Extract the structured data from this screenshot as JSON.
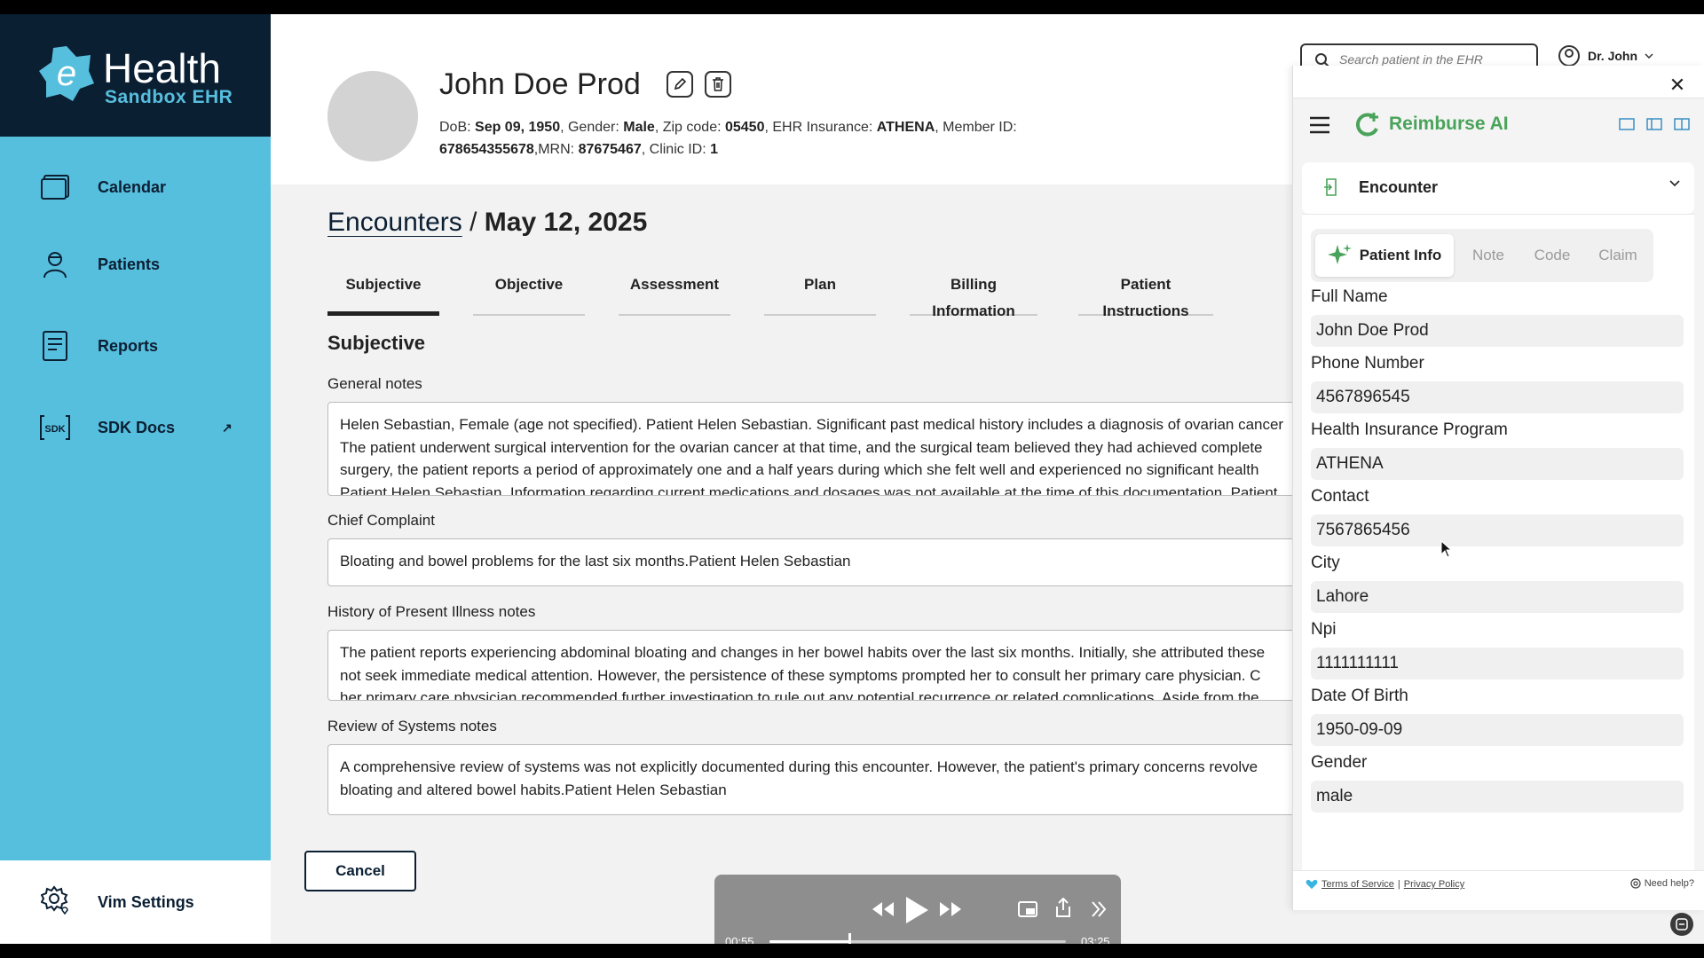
{
  "brand": {
    "name": "Health",
    "subtitle": "Sandbox EHR"
  },
  "sidebar": {
    "items": [
      {
        "label": "Calendar",
        "icon": "calendar-icon"
      },
      {
        "label": "Patients",
        "icon": "user-icon"
      },
      {
        "label": "Reports",
        "icon": "report-icon"
      },
      {
        "label": "SDK Docs",
        "icon": "sdk-icon",
        "external": "↗"
      }
    ],
    "settings_label": "Vim Settings"
  },
  "header": {
    "patient_name": "John Doe Prod",
    "dob_label": "DoB: ",
    "dob": "Sep 09, 1950",
    "gender_label": ", Gender: ",
    "gender": "Male",
    "zip_label": ", Zip code: ",
    "zip": "05450",
    "insurance_label": ", EHR Insurance: ",
    "insurance": "ATHENA",
    "member_label": ", Member ID: ",
    "member_id": "678654355678",
    "mrn_label": ",MRN: ",
    "mrn": "87675467",
    "clinic_label": ", Clinic ID: ",
    "clinic_id": "1",
    "search_placeholder": "Search patient in the EHR",
    "user_name": "Dr. John"
  },
  "breadcrumb": {
    "link": "Encounters",
    "separator": " / ",
    "current": "May 12, 2025"
  },
  "tabs": [
    "Subjective",
    "Objective",
    "Assessment",
    "Plan",
    "Billing Information",
    "Patient Instructions"
  ],
  "section_title": "Subjective",
  "fields": {
    "general_notes": {
      "label": "General notes",
      "lines": [
        "Helen Sebastian, Female (age not specified). Patient Helen Sebastian. Significant past medical history includes a diagnosis of ovarian cancer",
        "The patient underwent surgical intervention for the ovarian cancer at that time, and the surgical team believed they had achieved complete",
        "surgery, the patient reports a period of approximately one and a half years during which she felt well and experienced no significant health",
        "Patient Helen Sebastian. Information regarding current medications and dosages was not available at the time of this documentation. Patient"
      ]
    },
    "chief_complaint": {
      "label": "Chief Complaint",
      "lines": [
        "Bloating and bowel problems for the last six months.Patient Helen Sebastian"
      ]
    },
    "hpi": {
      "label": "History of Present Illness notes",
      "lines": [
        "The patient reports experiencing abdominal bloating and changes in her bowel habits over the last six months. Initially, she attributed these",
        "not seek immediate medical attention.  However, the persistence of these symptoms prompted her to consult her primary care physician.  C",
        "her primary care physician recommended further investigation to rule out any potential recurrence or related complications.  Aside from the"
      ]
    },
    "ros": {
      "label": "Review of Systems notes",
      "lines": [
        "A comprehensive review of systems was not explicitly documented during this encounter. However, the patient's primary concerns revolve",
        "bloating and altered bowel habits.Patient Helen Sebastian"
      ]
    }
  },
  "cancel_label": "Cancel",
  "player": {
    "current_time": "00:55",
    "total_time": "03:25",
    "progress": 0.268
  },
  "panel": {
    "app_name": "Reimburse AI",
    "section": "Encounter",
    "tabs": [
      "Patient Info",
      "Note",
      "Code",
      "Claim"
    ],
    "patient_info": [
      {
        "label": "Full Name",
        "value": "John Doe Prod"
      },
      {
        "label": "Phone Number",
        "value": "4567896545"
      },
      {
        "label": "Health Insurance Program",
        "value": "ATHENA"
      },
      {
        "label": "Contact",
        "value": "7567865456"
      },
      {
        "label": "City",
        "value": "Lahore"
      },
      {
        "label": "Npi",
        "value": "1111111111"
      },
      {
        "label": "Date Of Birth",
        "value": "1950-09-09"
      },
      {
        "label": "Gender",
        "value": "male"
      }
    ],
    "footer": {
      "terms": "Terms of Service",
      "divider": " | ",
      "privacy": "Privacy Policy",
      "help": "Need help?"
    }
  },
  "colors": {
    "sidebar": "#57bfde",
    "navy": "#0b1f33",
    "accent_green": "#4aa35a",
    "toolbar_active": "#0c6a8f"
  }
}
